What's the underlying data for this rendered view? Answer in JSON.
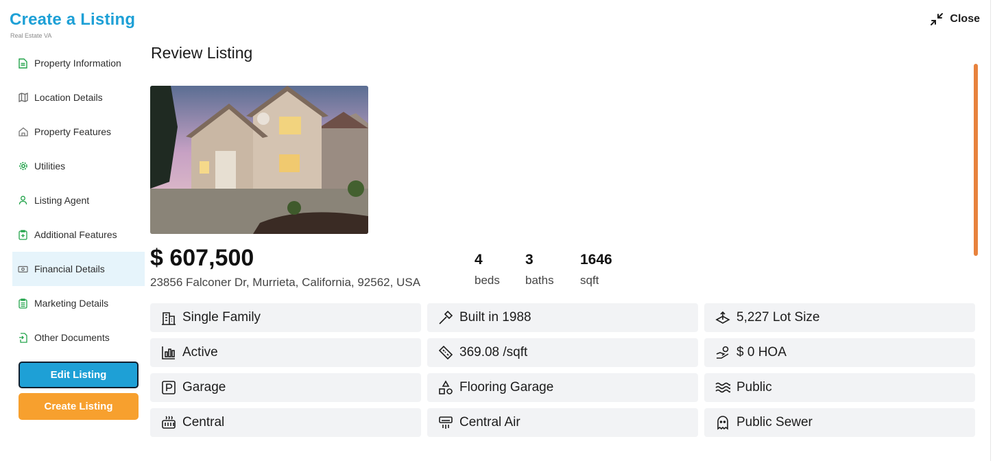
{
  "app": {
    "title": "Create a Listing",
    "subtitle": "Real Estate VA",
    "close_label": "Close"
  },
  "sidebar": {
    "items": [
      {
        "label": "Property Information",
        "icon": "document-icon"
      },
      {
        "label": "Location Details",
        "icon": "map-icon"
      },
      {
        "label": "Property Features",
        "icon": "home-icon"
      },
      {
        "label": "Utilities",
        "icon": "gear-icon"
      },
      {
        "label": "Listing Agent",
        "icon": "user-icon"
      },
      {
        "label": "Additional Features",
        "icon": "clipboard-plus-icon"
      },
      {
        "label": "Financial Details",
        "icon": "money-icon"
      },
      {
        "label": "Marketing Details",
        "icon": "clipboard-list-icon"
      },
      {
        "label": "Other Documents",
        "icon": "file-export-icon"
      }
    ],
    "active_index": 6
  },
  "actions": {
    "edit_label": "Edit Listing",
    "create_label": "Create Listing"
  },
  "review": {
    "title": "Review Listing",
    "price": "$ 607,500",
    "address": "23856 Falconer Dr, Murrieta, California, 92562, USA",
    "stats": [
      {
        "value": "4",
        "label": "beds"
      },
      {
        "value": "3",
        "label": "baths"
      },
      {
        "value": "1646",
        "label": "sqft"
      }
    ],
    "features": [
      {
        "text": "Single Family",
        "icon": "building-icon"
      },
      {
        "text": "Built in 1988",
        "icon": "hammer-icon"
      },
      {
        "text": "5,227 Lot Size",
        "icon": "lot-size-icon"
      },
      {
        "text": "Active",
        "icon": "bar-chart-icon"
      },
      {
        "text": "369.08 /sqft",
        "icon": "ruler-icon"
      },
      {
        "text": "$ 0 HOA",
        "icon": "hand-coins-icon"
      },
      {
        "text": "Garage",
        "icon": "parking-icon"
      },
      {
        "text": "Flooring Garage",
        "icon": "shapes-icon"
      },
      {
        "text": "Public",
        "icon": "waves-icon"
      },
      {
        "text": "Central",
        "icon": "heater-icon"
      },
      {
        "text": "Central Air",
        "icon": "air-conditioner-icon"
      },
      {
        "text": "Public Sewer",
        "icon": "ghost-icon"
      }
    ]
  },
  "colors": {
    "brand": "#1ea0d6",
    "accent": "#f7a02e",
    "scrollbar": "#e8823d",
    "active_nav": "#e6f4fb"
  }
}
